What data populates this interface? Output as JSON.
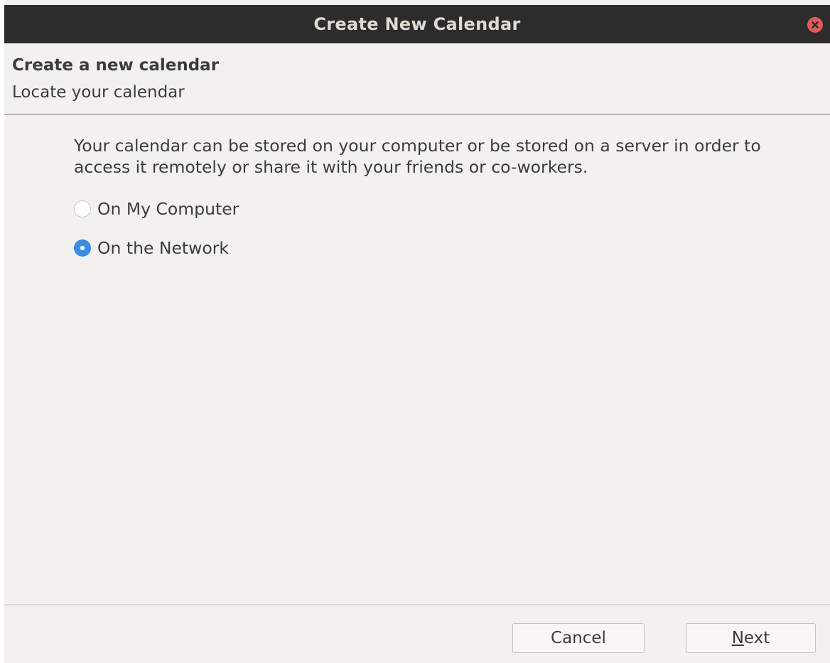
{
  "window": {
    "title": "Create New Calendar"
  },
  "header": {
    "title": "Create a new calendar",
    "subtitle": "Locate your calendar"
  },
  "content": {
    "description": "Your calendar can be stored on your computer or be stored on a server in order to access it remotely or share it with your friends or co-workers.",
    "options": [
      {
        "label": "On My Computer",
        "selected": false
      },
      {
        "label": "On the Network",
        "selected": true
      }
    ]
  },
  "footer": {
    "cancel_label": "Cancel",
    "next_mnemonic": "N",
    "next_rest": "ext"
  },
  "colors": {
    "titlebar": "#2c2c2a",
    "close_button": "#e05a5a",
    "radio_selected": "#3d8ee3",
    "background": "#f2f1f0"
  }
}
